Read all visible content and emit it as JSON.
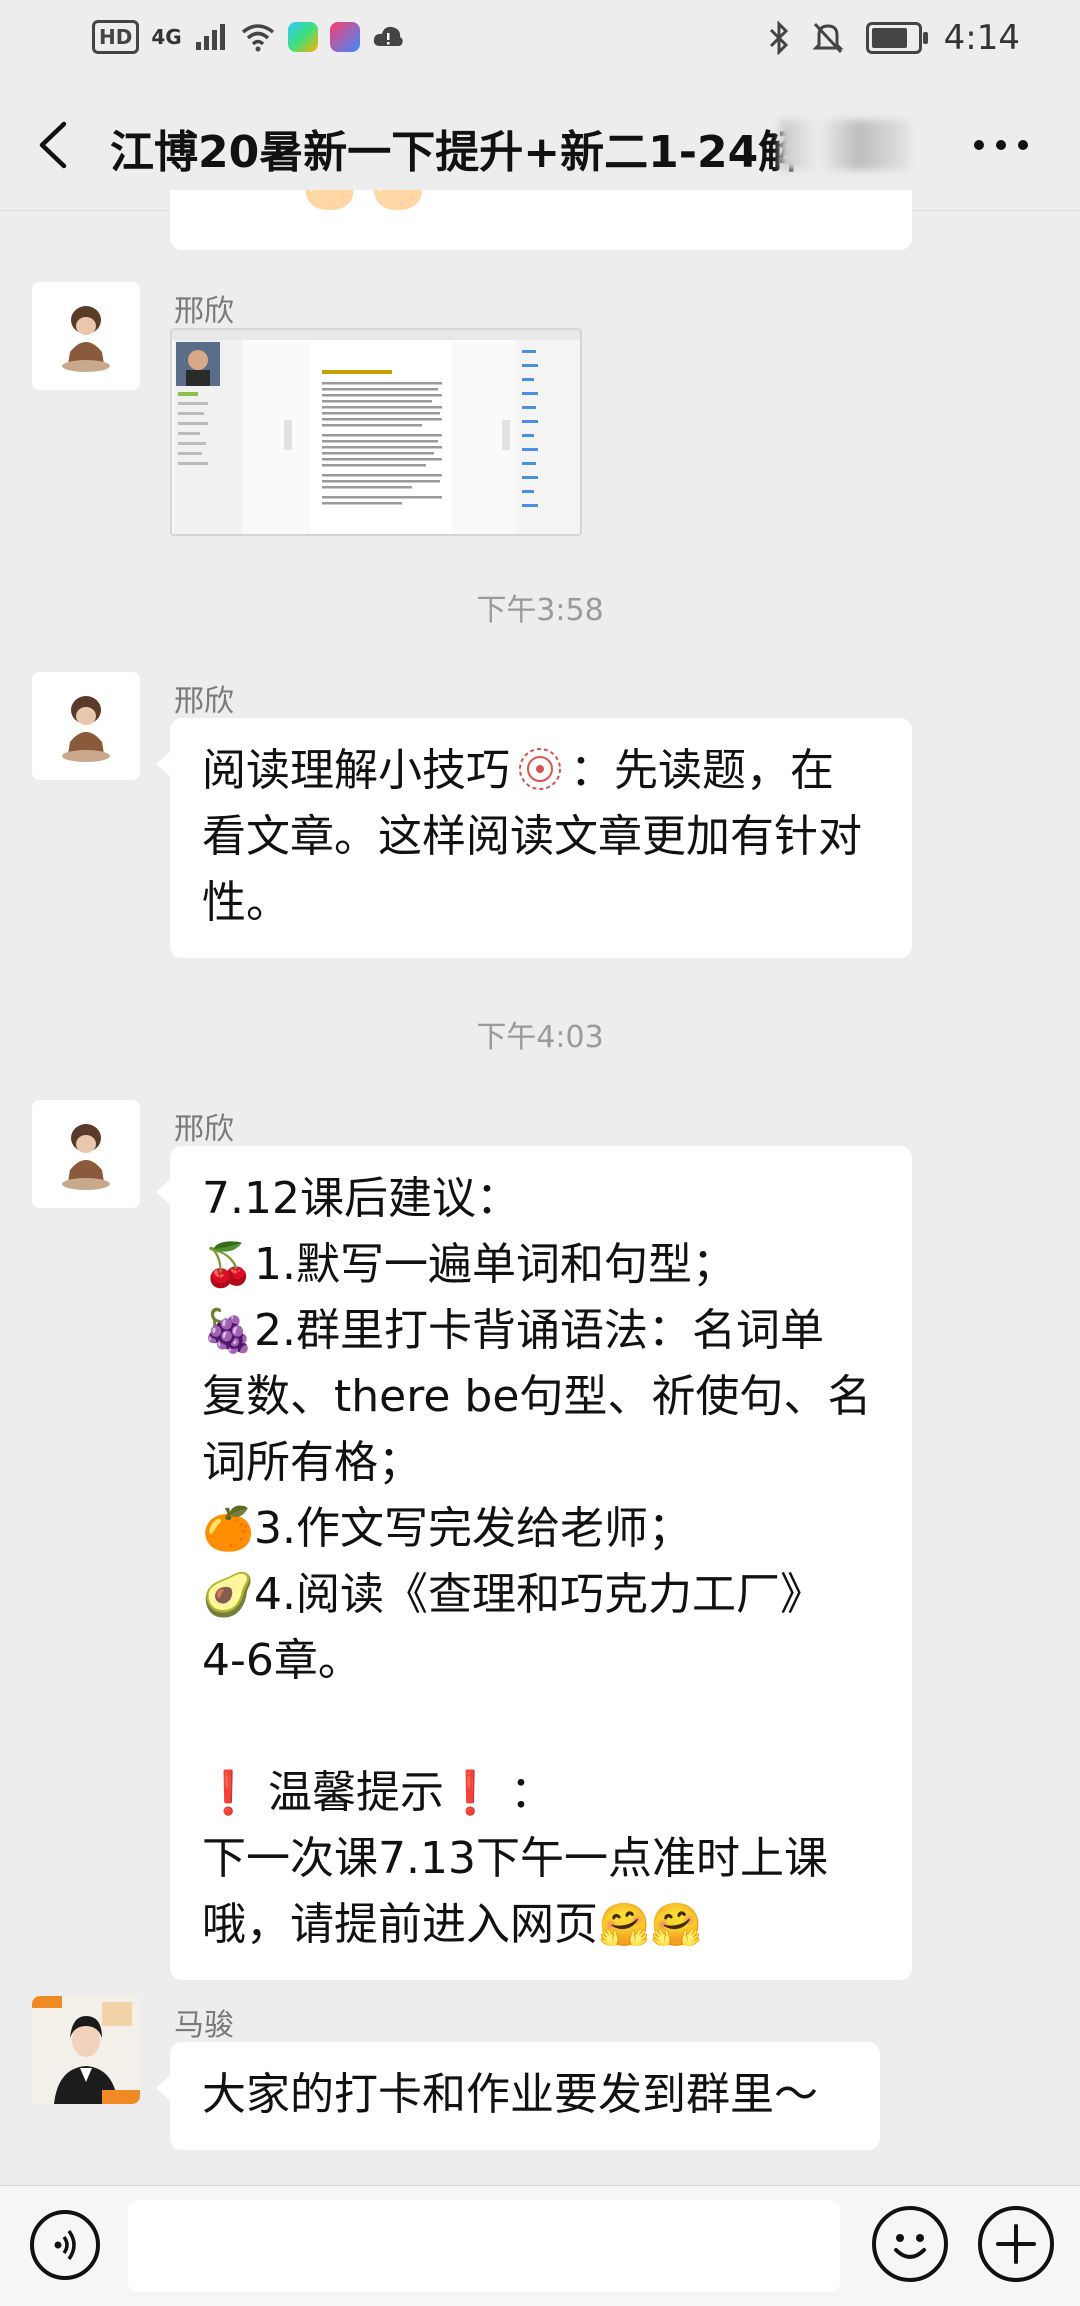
{
  "status_bar": {
    "hd": "HD",
    "network": "4G",
    "time": "4:14"
  },
  "header": {
    "title": "江博20暑新一下提升+新二1-24解"
  },
  "messages": [
    {
      "type": "image",
      "sender": "邢欣"
    },
    {
      "type": "time",
      "text": "下午3:58"
    },
    {
      "type": "text",
      "sender": "邢欣",
      "lines": [
        "阅读理解小技巧",
        "：先读题，在",
        "看文章。这样阅读文章更加有针对",
        "性。"
      ]
    },
    {
      "type": "time",
      "text": "下午4:03"
    },
    {
      "type": "text",
      "sender": "邢欣",
      "lines": [
        "7.12课后建议：",
        "1.默写一遍单词和句型；",
        "2.群里打卡背诵语法：名词单",
        "复数、there be句型、祈使句、名",
        "词所有格；",
        "3.作文写完发给老师；",
        "4.阅读《查理和巧克力工厂》",
        "4-6章。",
        "",
        "温馨提示",
        "：",
        "下一次课7.13下午一点准时上课",
        "哦，请提前进入网页"
      ],
      "emojis": [
        "🍒",
        "🍇",
        "🍊",
        "🥑",
        "❗",
        "❗",
        "🤗",
        "🤗"
      ]
    },
    {
      "type": "text",
      "sender": "马骏",
      "lines": [
        "大家的打卡和作业要发到群里～"
      ]
    }
  ],
  "colors": {
    "background": "#ededed",
    "bubble": "#ffffff",
    "nickname": "#7a7a7a",
    "timestamp": "#9a9a9a"
  },
  "icons": [
    "back-arrow-icon",
    "more-icon",
    "voice-icon",
    "emoji-icon",
    "plus-icon",
    "bluetooth-icon",
    "mute-icon",
    "battery-icon",
    "wifi-icon",
    "signal-icon"
  ]
}
